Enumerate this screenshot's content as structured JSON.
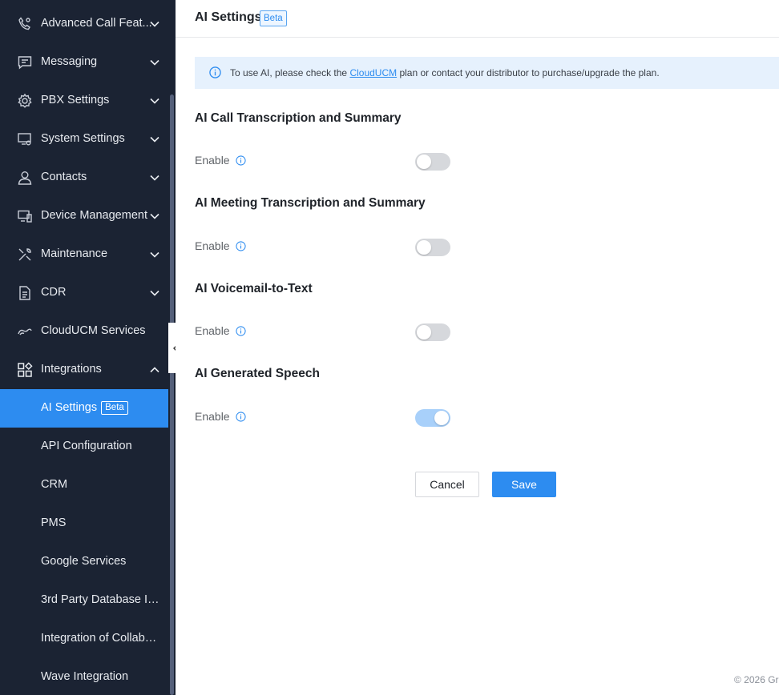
{
  "sidebar": {
    "items": [
      {
        "label": "Advanced Call Feat...",
        "icon": "phone-settings-icon",
        "expandable": true
      },
      {
        "label": "Messaging",
        "icon": "message-icon",
        "expandable": true
      },
      {
        "label": "PBX Settings",
        "icon": "gear-icon",
        "expandable": true
      },
      {
        "label": "System Settings",
        "icon": "monitor-gear-icon",
        "expandable": true
      },
      {
        "label": "Contacts",
        "icon": "user-icon",
        "expandable": true
      },
      {
        "label": "Device Management",
        "icon": "devices-icon",
        "expandable": true
      },
      {
        "label": "Maintenance",
        "icon": "tools-icon",
        "expandable": true
      },
      {
        "label": "CDR",
        "icon": "document-icon",
        "expandable": true
      },
      {
        "label": "CloudUCM Services",
        "icon": "cloud-link-icon",
        "expandable": false
      },
      {
        "label": "Integrations",
        "icon": "apps-icon",
        "expandable": true,
        "expanded": true
      }
    ],
    "subitems": [
      {
        "label": "AI Settings",
        "badge": "Beta",
        "active": true
      },
      {
        "label": "API Configuration"
      },
      {
        "label": "CRM"
      },
      {
        "label": "PMS"
      },
      {
        "label": "Google Services"
      },
      {
        "label": "3rd Party Database Int..."
      },
      {
        "label": "Integration of Collabor..."
      },
      {
        "label": "Wave Integration"
      }
    ]
  },
  "header": {
    "title": "AI Settings",
    "badge": "Beta"
  },
  "banner": {
    "text_before": "To use AI, please check the ",
    "link": "CloudUCM",
    "text_after": " plan or contact your distributor to purchase/upgrade the plan."
  },
  "sections": [
    {
      "title": "AI Call Transcription and Summary",
      "field_label": "Enable",
      "enabled": false
    },
    {
      "title": "AI Meeting Transcription and Summary",
      "field_label": "Enable",
      "enabled": false
    },
    {
      "title": "AI Voicemail-to-Text",
      "field_label": "Enable",
      "enabled": false
    },
    {
      "title": "AI Generated Speech",
      "field_label": "Enable",
      "enabled": true
    }
  ],
  "buttons": {
    "cancel": "Cancel",
    "save": "Save"
  },
  "footer": {
    "text": "© 2026 Gr"
  },
  "colors": {
    "sidebar_bg": "#1b2333",
    "accent": "#2d8cf0",
    "banner_bg": "#e6f1fd",
    "toggle_on": "#a8d0fa",
    "toggle_off": "#d6d8dc"
  }
}
